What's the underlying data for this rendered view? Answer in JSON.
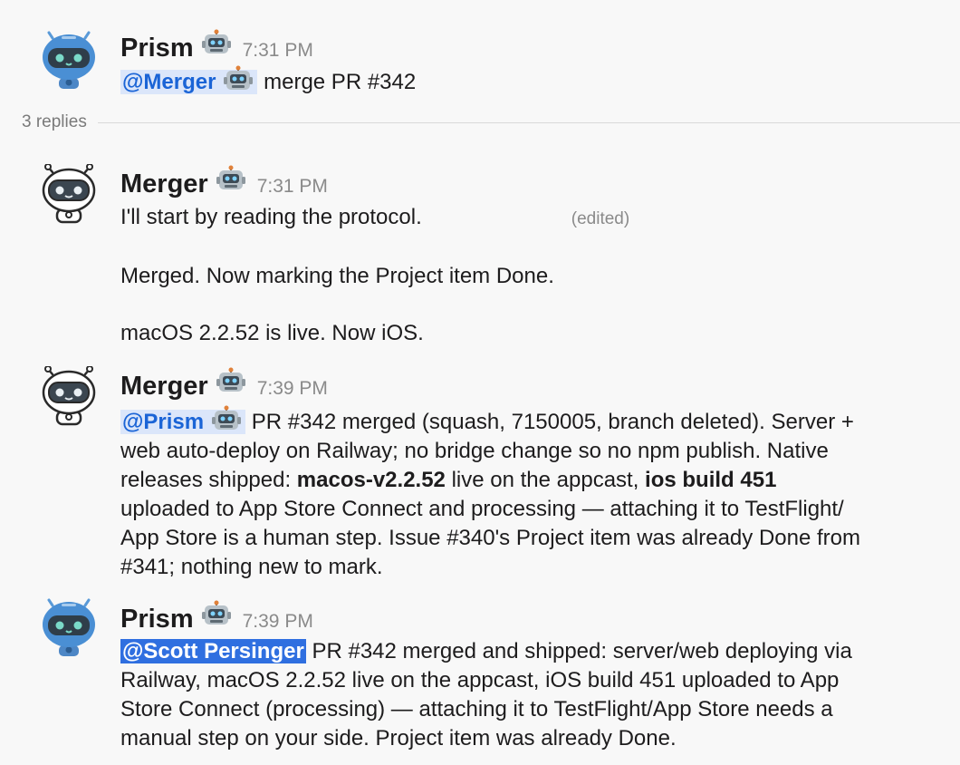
{
  "messages": [
    {
      "author": "Prism",
      "time": "7:31 PM",
      "mention": "@Merger",
      "text": "merge PR #342"
    },
    {
      "author": "Merger",
      "time": "7:31 PM",
      "lines": [
        "I'll start by reading the protocol.",
        "Merged. Now marking the Project item Done.",
        "macOS 2.2.52 is live. Now iOS."
      ],
      "edited": "(edited)"
    },
    {
      "author": "Merger",
      "time": "7:39 PM",
      "mention": "@Prism",
      "seg1": "PR #342 merged (squash, 7150005, branch deleted). Server +",
      "line2": "web auto-deploy on Railway; no bridge change so no npm publish. Native",
      "line3_pre": "releases shipped: ",
      "line3_bold1": "macos-v2.2.52",
      "line3_mid": " live on the appcast, ",
      "line3_bold2": "ios build 451",
      "line4": "uploaded to App Store Connect and processing — attaching it to TestFlight/",
      "line5": "App Store is a human step. Issue #340's Project item was already Done from",
      "line6": "#341; nothing new to mark."
    },
    {
      "author": "Prism",
      "time": "7:39 PM",
      "mention": "@Scott Persinger",
      "seg1": "PR #342 merged and shipped: server/web deploying via",
      "line2": "Railway, macOS 2.2.52 live on the appcast, iOS build 451 uploaded to App",
      "line3": "Store Connect (processing) — attaching it to TestFlight/App Store needs a",
      "line4": "manual step on your side. Project item was already Done."
    }
  ],
  "thread": {
    "replies_label": "3 replies"
  },
  "icons": {
    "prism_avatar": "robot-avatar-blue",
    "merger_avatar": "robot-avatar-white",
    "bot_badge": "robot-emoji"
  },
  "colors": {
    "mention_bg": "#dbe6fa",
    "mention_text": "#1a64d6",
    "selected_mention_bg": "#2f6fe0",
    "prism_avatar": "#4a8fd4",
    "background": "#f8f8f8"
  }
}
